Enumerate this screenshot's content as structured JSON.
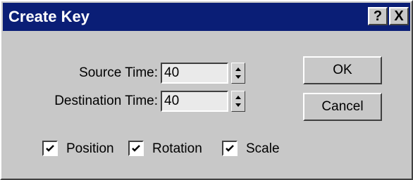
{
  "window": {
    "title": "Create Key",
    "help_label": "?",
    "close_label": "X"
  },
  "fields": {
    "source_time": {
      "label": "Source Time:",
      "value": "40"
    },
    "destination_time": {
      "label": "Destination Time:",
      "value": "40"
    }
  },
  "buttons": {
    "ok_label": "OK",
    "cancel_label": "Cancel"
  },
  "checkboxes": [
    {
      "label": "Position",
      "checked": true
    },
    {
      "label": "Rotation",
      "checked": true
    },
    {
      "label": "Scale",
      "checked": true
    }
  ],
  "colors": {
    "titlebar": "#0a1e76",
    "face": "#c8c8c8",
    "field_bg": "#eaeaea"
  }
}
